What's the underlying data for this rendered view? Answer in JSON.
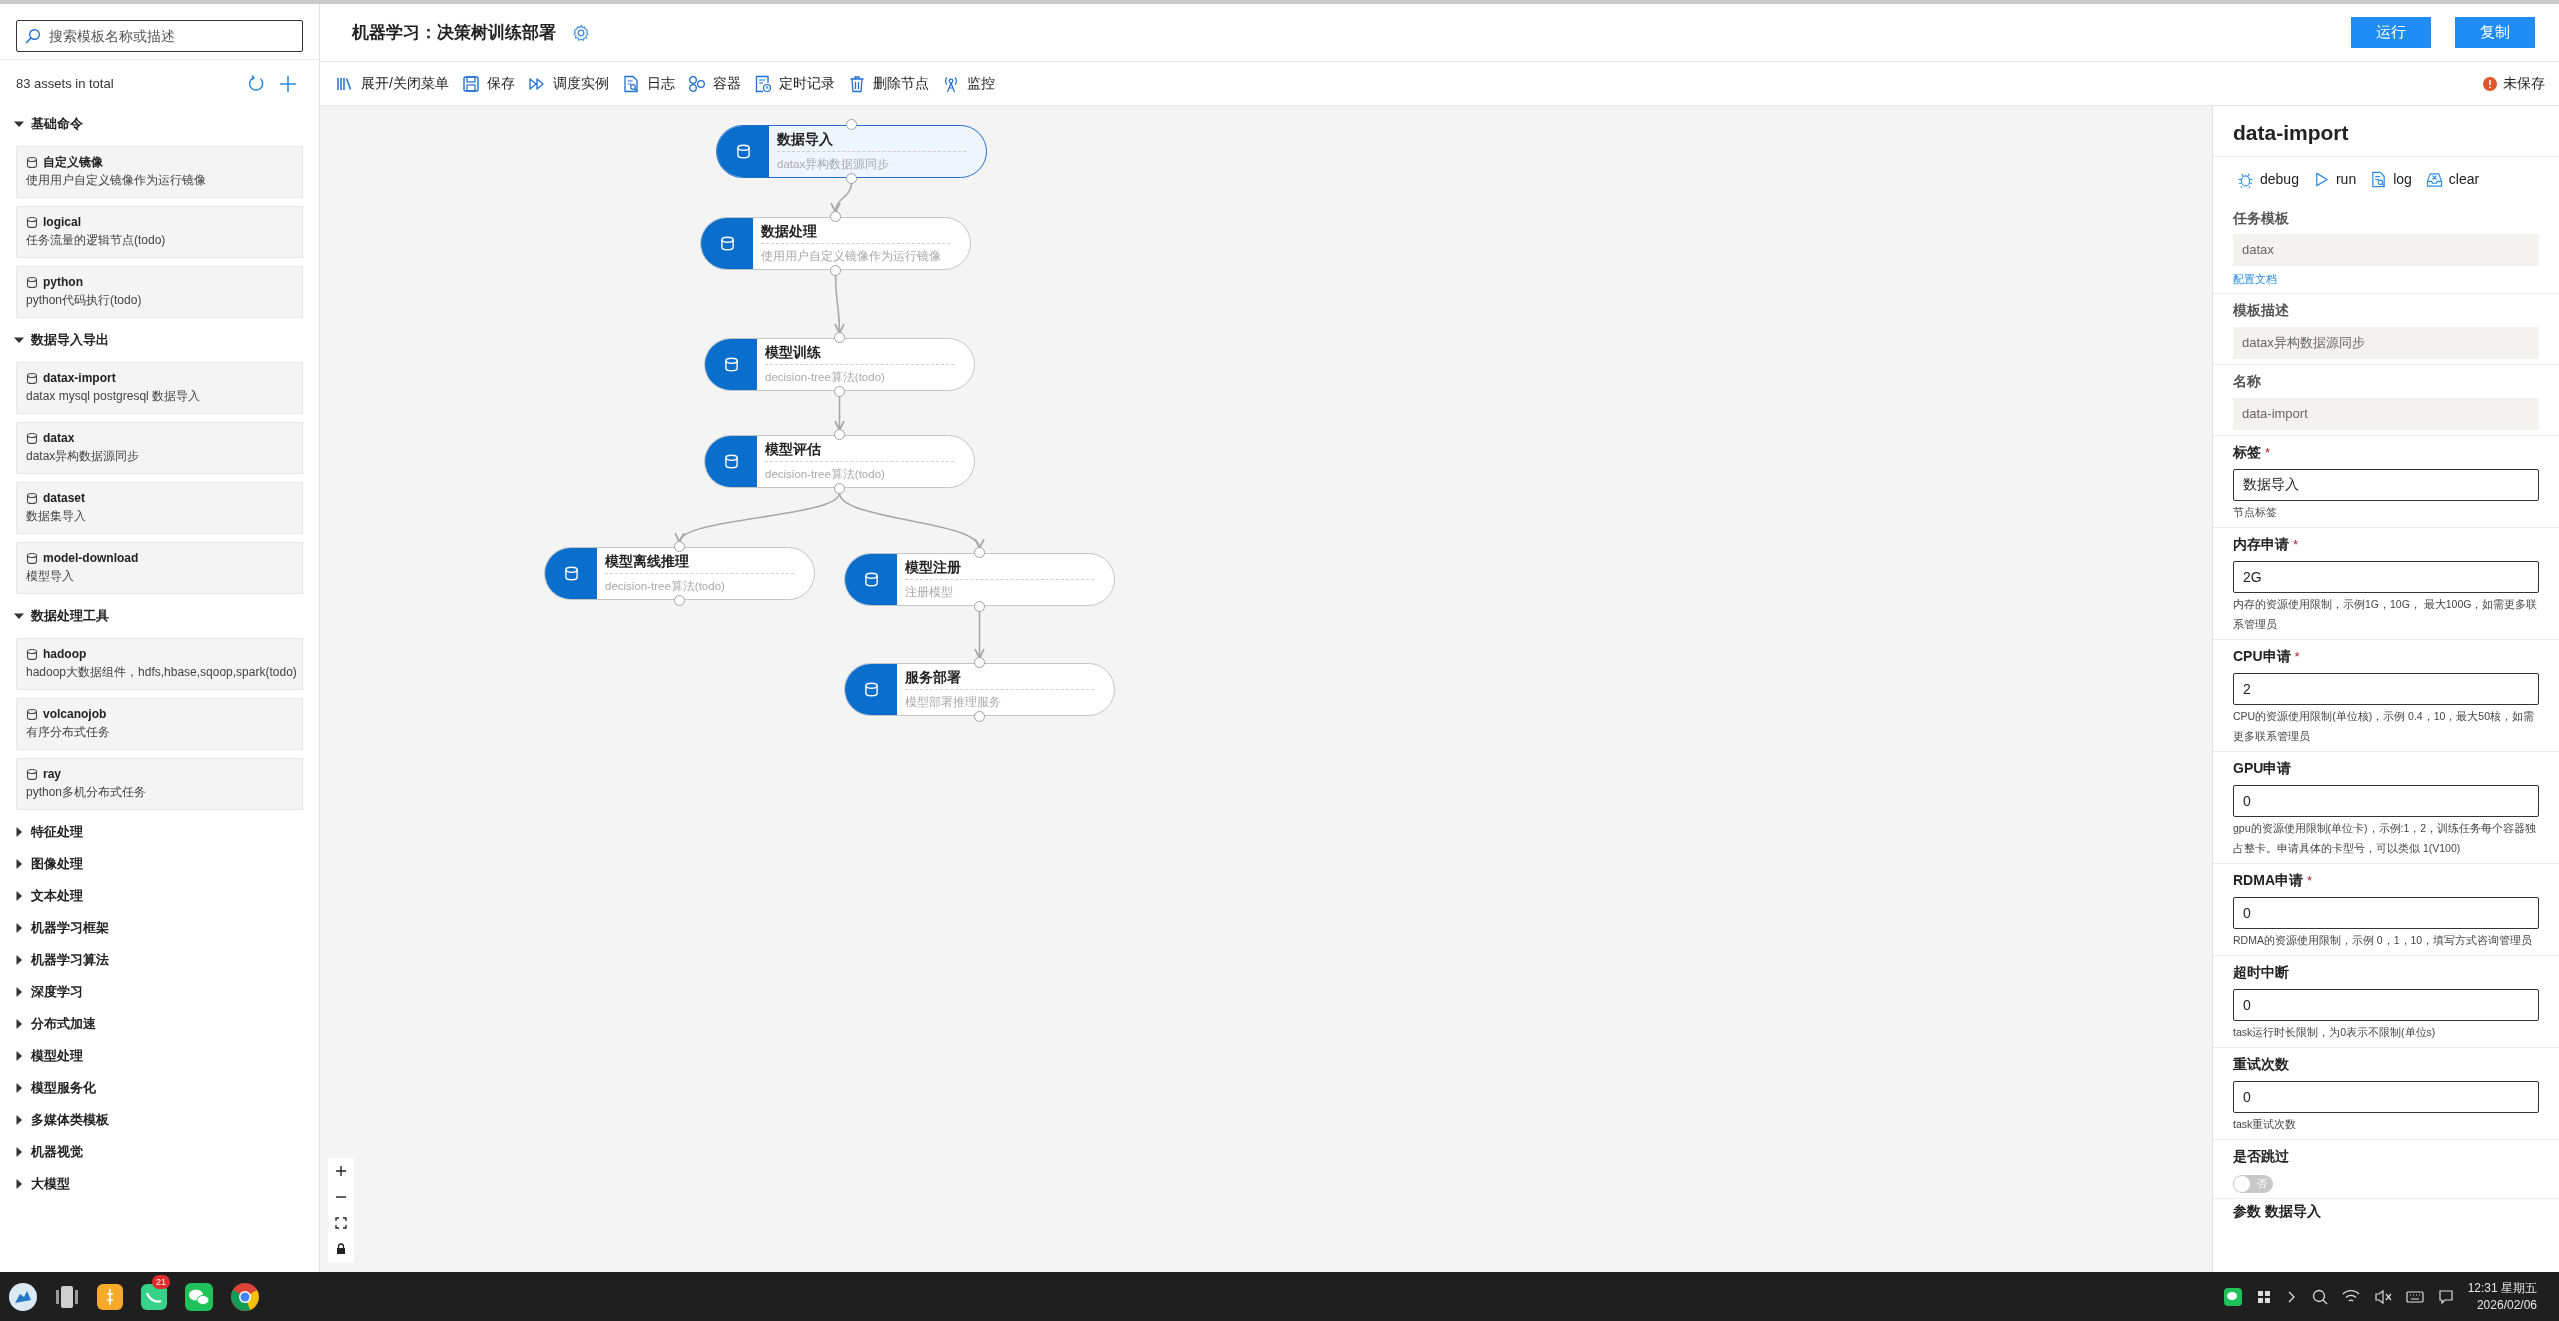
{
  "sidebar": {
    "search": {
      "placeholder": "搜索模板名称或描述"
    },
    "total": "83 assets in total",
    "categories": [
      {
        "title": "基础命令",
        "expanded": true,
        "items": [
          {
            "name": "自定义镜像",
            "desc": "使用用户自定义镜像作为运行镜像"
          },
          {
            "name": "logical",
            "desc": "任务流量的逻辑节点(todo)"
          },
          {
            "name": "python",
            "desc": "python代码执行(todo)"
          }
        ]
      },
      {
        "title": "数据导入导出",
        "expanded": true,
        "items": [
          {
            "name": "datax-import",
            "desc": "datax mysql postgresql 数据导入"
          },
          {
            "name": "datax",
            "desc": "datax异构数据源同步"
          },
          {
            "name": "dataset",
            "desc": "数据集导入"
          },
          {
            "name": "model-download",
            "desc": "模型导入"
          }
        ]
      },
      {
        "title": "数据处理工具",
        "expanded": true,
        "items": [
          {
            "name": "hadoop",
            "desc": "hadoop大数据组件，hdfs,hbase,sqoop,spark(todo)"
          },
          {
            "name": "volcanojob",
            "desc": "有序分布式任务"
          },
          {
            "name": "ray",
            "desc": "python多机分布式任务"
          }
        ]
      },
      {
        "title": "特征处理",
        "expanded": false
      },
      {
        "title": "图像处理",
        "expanded": false
      },
      {
        "title": "文本处理",
        "expanded": false
      },
      {
        "title": "机器学习框架",
        "expanded": false
      },
      {
        "title": "机器学习算法",
        "expanded": false
      },
      {
        "title": "深度学习",
        "expanded": false
      },
      {
        "title": "分布式加速",
        "expanded": false
      },
      {
        "title": "模型处理",
        "expanded": false
      },
      {
        "title": "模型服务化",
        "expanded": false
      },
      {
        "title": "多媒体类模板",
        "expanded": false
      },
      {
        "title": "机器视觉",
        "expanded": false
      },
      {
        "title": "大模型",
        "expanded": false
      }
    ]
  },
  "header": {
    "title": "机器学习：决策树训练部署",
    "buttons": [
      "运行",
      "复制"
    ]
  },
  "toolbar": {
    "items": [
      {
        "kind": "menu",
        "label": "展开/关闭菜单"
      },
      {
        "kind": "save",
        "label": "保存"
      },
      {
        "kind": "schedule",
        "label": "调度实例"
      },
      {
        "kind": "log",
        "label": "日志"
      },
      {
        "kind": "container",
        "label": "容器"
      },
      {
        "kind": "timer",
        "label": "定时记录"
      },
      {
        "kind": "delete",
        "label": "删除节点"
      },
      {
        "kind": "monitor",
        "label": "监控"
      }
    ],
    "status": "未保存"
  },
  "canvas": {
    "nodes": [
      {
        "title": "数据导入",
        "desc": "datax异构数据源同步",
        "selected": true
      },
      {
        "title": "数据处理",
        "desc": "使用用户自定义镜像作为运行镜像",
        "selected": false
      },
      {
        "title": "模型训练",
        "desc": "decision-tree算法(todo)",
        "selected": false
      },
      {
        "title": "模型评估",
        "desc": "decision-tree算法(todo)",
        "selected": false
      },
      {
        "title": "模型离线推理",
        "desc": "decision-tree算法(todo)",
        "selected": false
      },
      {
        "title": "模型注册",
        "desc": "注册模型",
        "selected": false
      },
      {
        "title": "服务部署",
        "desc": "模型部署推理服务",
        "selected": false
      }
    ]
  },
  "panel": {
    "title": "data-import",
    "actions": [
      {
        "kind": "debug",
        "label": "debug"
      },
      {
        "kind": "run",
        "label": "run"
      },
      {
        "kind": "log",
        "label": "log"
      },
      {
        "kind": "clear",
        "label": "clear"
      }
    ],
    "fields": [
      {
        "kind": "readonly",
        "label": "任务模板",
        "value": "datax",
        "link": "配置文档"
      },
      {
        "kind": "readonly",
        "label": "模板描述",
        "value": "datax异构数据源同步"
      },
      {
        "kind": "readonly",
        "label": "名称",
        "value": "data-import"
      },
      {
        "kind": "input",
        "label": "标签",
        "required_mark": "*",
        "value": "数据导入",
        "help": "节点标签"
      },
      {
        "kind": "input",
        "label": "内存申请",
        "required_mark": "*",
        "value": "2G",
        "help": "内存的资源使用限制，示例1G，10G， 最大100G，如需更多联系管理员"
      },
      {
        "kind": "input",
        "label": "CPU申请",
        "required_mark": "*",
        "value": "2",
        "help": "CPU的资源使用限制(单位核)，示例 0.4，10，最大50核，如需更多联系管理员"
      },
      {
        "kind": "input",
        "label": "GPU申请",
        "value": "0",
        "help": "gpu的资源使用限制(单位卡)，示例:1，2，训练任务每个容器独占整卡。申请具体的卡型号，可以类似 1(V100)"
      },
      {
        "kind": "input",
        "label": "RDMA申请",
        "required_mark": "*",
        "value": "0",
        "help": "RDMA的资源使用限制，示例 0，1，10，填写方式咨询管理员"
      },
      {
        "kind": "input",
        "label": "超时中断",
        "value": "0",
        "help": "task运行时长限制，为0表示不限制(单位s)"
      },
      {
        "kind": "input",
        "label": "重试次数",
        "value": "0",
        "help": "task重试次数"
      },
      {
        "kind": "toggle",
        "label": "是否跳过",
        "on": false,
        "text": "否"
      }
    ],
    "section_title": "参数 数据导入"
  },
  "taskbar": {
    "badge": "21",
    "time": "12:31 星期五",
    "date": "2026/02/06"
  }
}
